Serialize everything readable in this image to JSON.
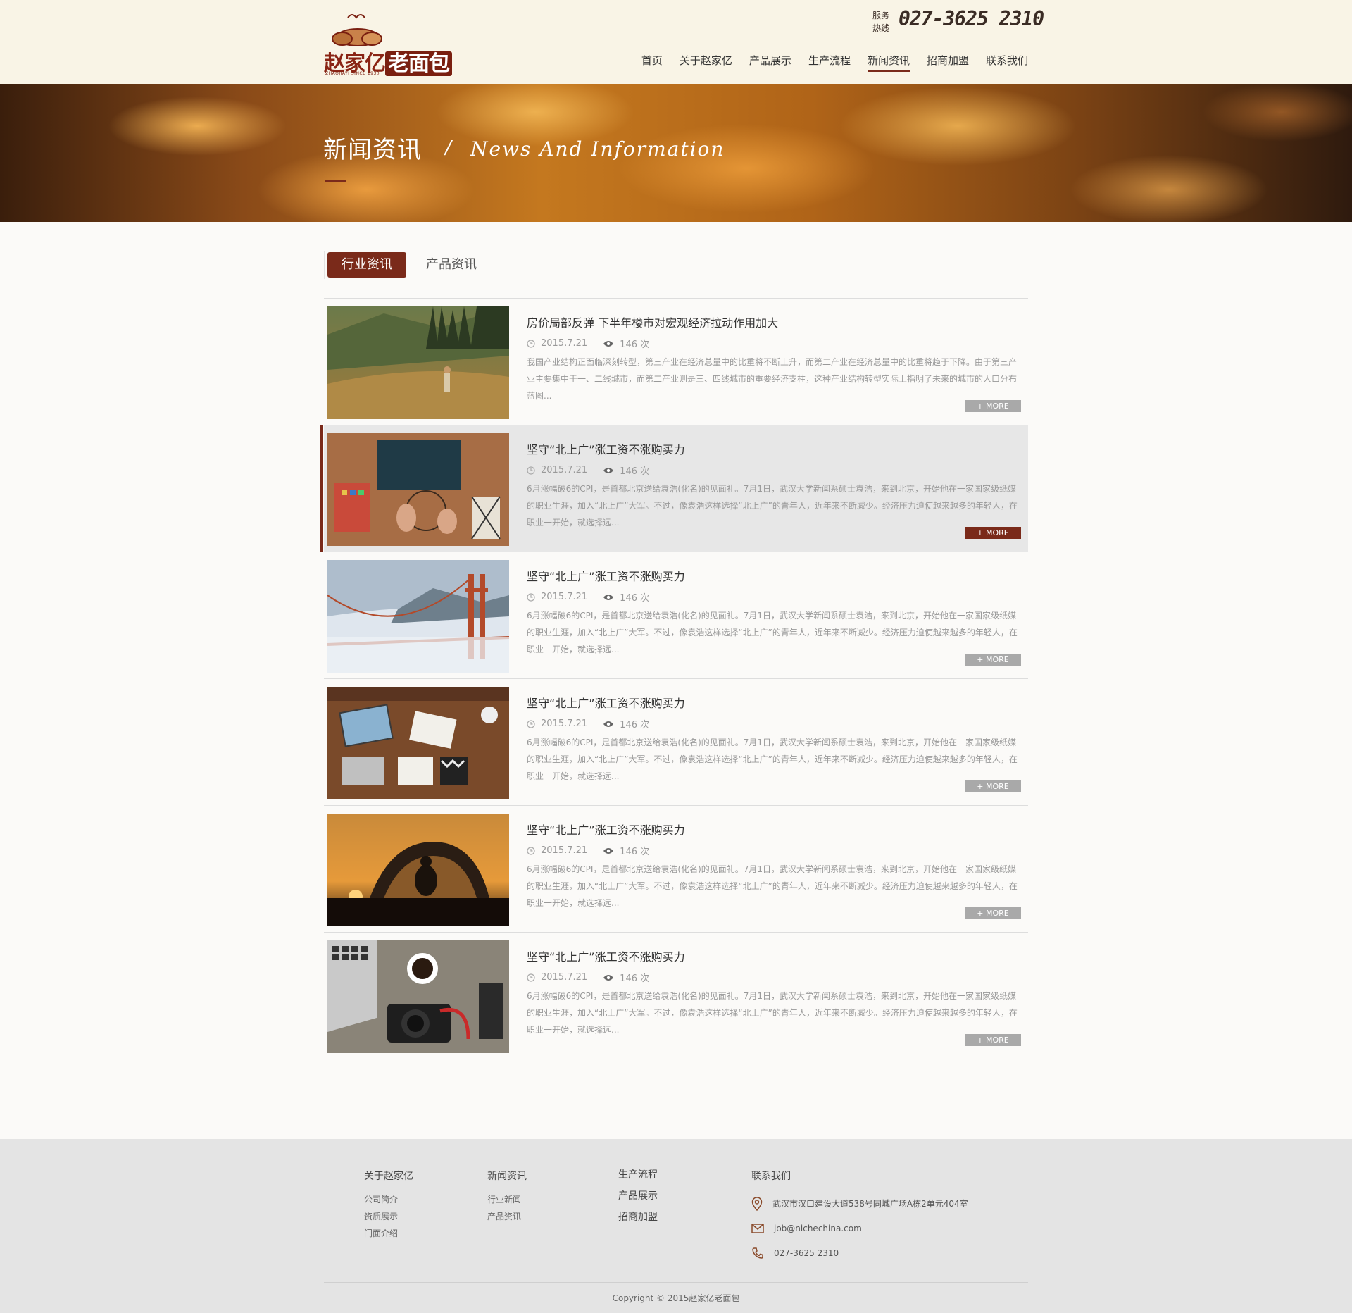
{
  "header": {
    "logo_text_main": "赵家亿",
    "logo_text_accent": "老面包",
    "logo_sub": "ZHAOJIAYI SINCE 1930",
    "hotline_label": "服务热线",
    "hotline_number": "027-3625 2310",
    "nav": [
      "首页",
      "关于赵家亿",
      "产品展示",
      "生产流程",
      "新闻资讯",
      "招商加盟",
      "联系我们"
    ],
    "nav_active_index": 4
  },
  "banner": {
    "title": "新闻资讯",
    "slash": "/",
    "subtitle_en": "News And Information"
  },
  "tabs": [
    "行业资讯",
    "产品资讯"
  ],
  "news": [
    {
      "title": "房价局部反弹 下半年楼市对宏观经济拉动作用加大",
      "date": "2015.7.21",
      "views": "146 次",
      "desc": "我国产业结构正面临深刻转型，第三产业在经济总量中的比重将不断上升，而第二产业在经济总量中的比重将趋于下降。由于第三产业主要集中于一、二线城市，而第二产业则是三、四线城市的重要经济支柱，这种产业结构转型实际上指明了未来的城市的人口分布蓝图...",
      "more": "+ MORE",
      "image": "mountain-hiker"
    },
    {
      "title": "坚守“北上广”涨工资不涨购买力",
      "date": "2015.7.21",
      "views": "146 次",
      "desc": "6月涨幅破6的CPI，是首都北京送给袁浩(化名)的见面礼。7月1日，武汉大学新闻系硕士袁浩，来到北京，开始他在一家国家级纸媒的职业生涯，加入“北上广”大军。不过，像袁浩这样选择“北上广”的青年人，近年来不断减少。经济压力迫使越来越多的年轻人，在职业一开始，就选择远...",
      "more": "+ MORE",
      "image": "craft-desk"
    },
    {
      "title": "坚守“北上广”涨工资不涨购买力",
      "date": "2015.7.21",
      "views": "146 次",
      "desc": "6月涨幅破6的CPI，是首都北京送给袁浩(化名)的见面礼。7月1日，武汉大学新闻系硕士袁浩，来到北京，开始他在一家国家级纸媒的职业生涯，加入“北上广”大军。不过，像袁浩这样选择“北上广”的青年人，近年来不断减少。经济压力迫使越来越多的年轻人，在职业一开始，就选择远...",
      "more": "+ MORE",
      "image": "golden-gate-bridge"
    },
    {
      "title": "坚守“北上广”涨工资不涨购买力",
      "date": "2015.7.21",
      "views": "146 次",
      "desc": "6月涨幅破6的CPI，是首都北京送给袁浩(化名)的见面礼。7月1日，武汉大学新闻系硕士袁浩，来到北京，开始他在一家国家级纸媒的职业生涯，加入“北上广”大军。不过，像袁浩这样选择“北上广”的青年人，近年来不断减少。经济压力迫使越来越多的年轻人，在职业一开始，就选择远...",
      "more": "+ MORE",
      "image": "laptops-on-wood-table"
    },
    {
      "title": "坚守“北上广”涨工资不涨购买力",
      "date": "2015.7.21",
      "views": "146 次",
      "desc": "6月涨幅破6的CPI，是首都北京送给袁浩(化名)的见面礼。7月1日，武汉大学新闻系硕士袁浩，来到北京，开始他在一家国家级纸媒的职业生涯，加入“北上广”大军。不过，像袁浩这样选择“北上广”的青年人，近年来不断减少。经济压力迫使越来越多的年轻人，在职业一开始，就选择远...",
      "more": "+ MORE",
      "image": "tent-sunset"
    },
    {
      "title": "坚守“北上广”涨工资不涨购买力",
      "date": "2015.7.21",
      "views": "146 次",
      "desc": "6月涨幅破6的CPI，是首都北京送给袁浩(化名)的见面礼。7月1日，武汉大学新闻系硕士袁浩，来到北京，开始他在一家国家级纸媒的职业生涯，加入“北上广”大军。不过，像袁浩这样选择“北上广”的青年人，近年来不断减少。经济压力迫使越来越多的年轻人，在职业一开始，就选择远...",
      "more": "+ MORE",
      "image": "laptop-coffee-camera"
    }
  ],
  "highlight_index": 1,
  "footer": {
    "col1": {
      "title": "关于赵家亿",
      "links": [
        "公司简介",
        "资质展示",
        "门面介绍"
      ]
    },
    "col2": {
      "title": "新闻资讯",
      "links": [
        "行业新闻",
        "产品资讯"
      ]
    },
    "col3": {
      "links": [
        "生产流程",
        "产品展示",
        "招商加盟"
      ]
    },
    "col4": {
      "title": "联系我们",
      "address": "武汉市汉口建设大道538号同城广场A栋2单元404室",
      "email": "job@nichechina.com",
      "phone": "027-3625 2310"
    },
    "copyright": "Copyright © 2015赵家亿老面包"
  },
  "colors": {
    "brand": "#7a2a1a",
    "header_bg": "#f9f4e6",
    "footer_bg": "#e4e4e4"
  }
}
